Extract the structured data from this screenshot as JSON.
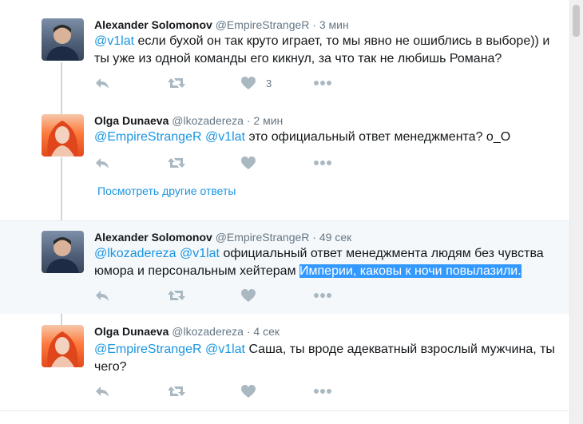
{
  "tweets": [
    {
      "name": "Alexander Solomonov",
      "handle": "@EmpireStrangeR",
      "dot": "·",
      "time": "3 мин",
      "mentions": "@v1lat",
      "text": " если бухой он так круто играет, то мы явно не ошиблись в выборе)) и ты уже из одной команды его кикнул, за что так не любишь Романа?",
      "like_count": "3"
    },
    {
      "name": "Olga Dunaeva",
      "handle": "@lkozadereza",
      "dot": "·",
      "time": "2 мин",
      "mentions": "@EmpireStrangeR @v1lat",
      "text": " это официальный ответ менеджмента? о_О"
    },
    {
      "name": "Alexander Solomonov",
      "handle": "@EmpireStrangeR",
      "dot": "·",
      "time": "49 сек",
      "mentions": "@lkozadereza @v1lat",
      "text": " официальный ответ менеджмента людям без чувства юмора и персональным хейтерам ",
      "highlight": "Империи, каковы к ночи повылазили."
    },
    {
      "name": "Olga Dunaeva",
      "handle": "@lkozadereza",
      "dot": "·",
      "time": "4 сек",
      "mentions": "@EmpireStrangeR @v1lat",
      "text": " Саша, ты вроде адекватный взрослый мужчина, ты чего?"
    }
  ],
  "show_more_label": "Посмотреть другие ответы",
  "colors": {
    "accent": "#1b95e0",
    "icon": "#aab8c2",
    "thread": "#ccd6dd",
    "selection": "#3399ff"
  },
  "icons": [
    "reply-icon",
    "retweet-icon",
    "like-icon",
    "more-icon"
  ]
}
